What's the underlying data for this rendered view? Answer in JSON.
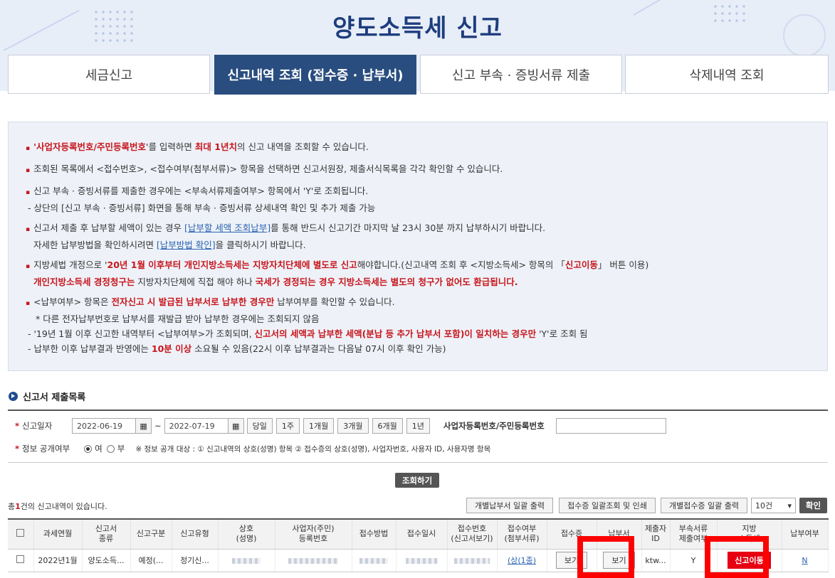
{
  "page_title": "양도소득세  신고",
  "tabs": [
    {
      "label": "세금신고"
    },
    {
      "label": "신고내역 조회 (접수증 · 납부서)"
    },
    {
      "label": "신고 부속 · 증빙서류 제출"
    },
    {
      "label": "삭제내역 조회"
    }
  ],
  "notice": {
    "l1a": "'",
    "l1b": "사업자등록번호/주민등록번호",
    "l1c": "'를 입력하면 ",
    "l1d": "최대 1년치",
    "l1e": "의 신고 내역을 조회할 수 있습니다.",
    "l2": "조회된 목록에서 <접수번호>, <접수여부(첨부서류)> 항목을 선택하면 신고서원장, 제출서식목록을 각각 확인할 수 있습니다.",
    "l3": "신고 부속 · 증빙서류를 제출한 경우에는 <부속서류제출여부> 항목에서 'Y'로 조회됩니다.",
    "l3b": "- 상단의 [신고 부속 · 증빙서류] 화면을 통해 부속 · 증빙서류 상세내역 확인 및 추가 제출 가능",
    "l4a": "신고서 제출 후 납부할 세액이 있는 경우 ",
    "l4link": "[납부할 세액 조회납부]",
    "l4b": "를 통해 반드시 신고기간 마지막 날 23시 30분 까지 납부하시기 바랍니다.",
    "l4c": "자세한 납부방법을 확인하시려면 ",
    "l4link2": "[납부방법 확인]",
    "l4d": "을 클릭하시기 바랍니다.",
    "l5a": "지방세법 개정으로 '",
    "l5b": "20년 1월 이후부터 개인지방소득세는 지방자치단체에 별도로 신고",
    "l5c": "해야합니다.(신고내역 조회 후 <지방소득세> 항목의 「",
    "l5d": "신고이동",
    "l5e": "」 버튼 이용)",
    "l5f": "개인지방소득세 경정청구는",
    "l5g": " 지방자치단체에 직접 해야 하나 ",
    "l5h": "국세가 경정되는 경우 지방소득세는 별도의 청구가 없어도 환급됩니다.",
    "l6a": "<납부여부> 항목은 ",
    "l6b": "전자신고 시 발급된 납부서로 납부한 경우만",
    "l6c": " 납부여부를 확인할 수 있습니다.",
    "l6d": "* 다른 전자납부번호로 납부서를 재발급 받아 납부한 경우에는 조회되지 않음",
    "l6e": "- '19년 1월 이후 신고한 내역부터 <납부여부>가 조회되며, ",
    "l6f": "신고서의 세액과 납부한 세액(분납 등 추가 납부서 포함)이 일치하는 경우만",
    "l6g": " 'Y'로 조회 됨",
    "l6h": "- 납부한 이후 납부결과 반영에는 ",
    "l6i": "10분 이상",
    "l6j": " 소요될 수 있음(22시 이후 납부결과는 다음날 07시 이후 확인 가능)"
  },
  "section_title": "신고서 제출목록",
  "search": {
    "date_label": "신고일자",
    "date_from": "2022-06-19",
    "tilde": "~",
    "date_to": "2022-07-19",
    "periods": [
      "당일",
      "1주",
      "1개월",
      "3개월",
      "6개월",
      "1년"
    ],
    "id_label": "사업자등록번호/주민등록번호",
    "public_label": "정보 공개여부",
    "yes": "여",
    "no": "부",
    "public_note": "※ 정보 공개 대상 : ① 신고내역의 상호(성명) 항목 ② 접수증의 상호(성명), 사업자번호, 사용자 ID, 사용자명 항목",
    "search_button": "조회하기"
  },
  "results": {
    "count_prefix": "총",
    "count": "1",
    "count_suffix": "건의 신고내역이 있습니다.",
    "buttons": [
      "개별납부서 일괄 출력",
      "접수증 일괄조회 및 인쇄",
      "개별접수증 일괄 출력"
    ],
    "page_size": "10건",
    "confirm": "확인"
  },
  "table": {
    "headers": [
      "과세연월",
      "신고서\n종류",
      "신고구분",
      "신고유형",
      "상호\n(성명)",
      "사업자(주민)\n등록번호",
      "접수방법",
      "접수일시",
      "접수번호\n(신고서보기)",
      "접수여부\n(첨부서류)",
      "접수증",
      "납부서",
      "제출자\nID",
      "부속서류\n제출여부",
      "지방\n소득세",
      "납부여부"
    ],
    "row": {
      "period": "2022년1월",
      "form": "양도소득...",
      "division": "예정(...",
      "type": "정기신...",
      "attach": "(상(1종)",
      "receipt_btn": "보기",
      "payment_btn": "보기",
      "submitter": "ktw...",
      "attached": "Y",
      "local_btn": "신고이동",
      "paid": "N"
    }
  }
}
